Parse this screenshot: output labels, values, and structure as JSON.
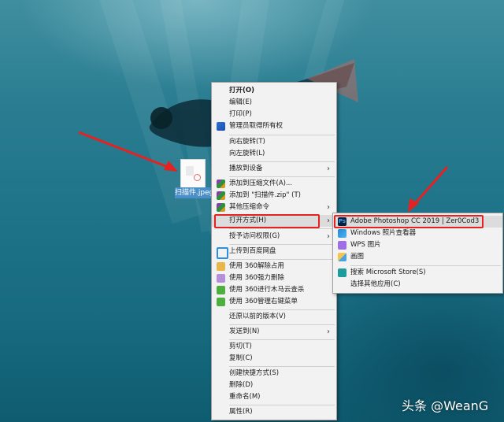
{
  "desktop": {
    "file_name": "扫描件.jpeg"
  },
  "context_menu": {
    "items": [
      {
        "label": "打开(O)",
        "bold": true
      },
      {
        "label": "编辑(E)"
      },
      {
        "label": "打印(P)"
      },
      {
        "label": "管理员取得所有权",
        "icon": "shield-icon"
      },
      {
        "label": "向右旋转(T)"
      },
      {
        "label": "向左旋转(L)"
      },
      {
        "label": "播放到设备",
        "submenu": true
      },
      {
        "label": "添加到压缩文件(A)...",
        "icon": "archive-icon"
      },
      {
        "label": "添加到 \"扫描件.zip\" (T)",
        "icon": "archive-icon"
      },
      {
        "label": "其他压缩命令",
        "icon": "archive-icon",
        "submenu": true
      },
      {
        "label": "打开方式(H)",
        "submenu": true,
        "highlighted": true
      },
      {
        "label": "授予访问权限(G)",
        "submenu": true
      },
      {
        "label": "上传到百度网盘",
        "icon": "cloud-icon"
      },
      {
        "label": "使用 360解除占用",
        "icon": "unlock-360-icon"
      },
      {
        "label": "使用 360强力删除",
        "icon": "delete-360-icon"
      },
      {
        "label": "使用 360进行木马云查杀",
        "icon": "scan-360-icon"
      },
      {
        "label": "使用 360管理右键菜单",
        "icon": "manage-360-icon"
      },
      {
        "label": "还原以前的版本(V)"
      },
      {
        "label": "发送到(N)",
        "submenu": true
      },
      {
        "label": "剪切(T)"
      },
      {
        "label": "复制(C)"
      },
      {
        "label": "创建快捷方式(S)"
      },
      {
        "label": "删除(D)"
      },
      {
        "label": "重命名(M)"
      },
      {
        "label": "属性(R)"
      }
    ],
    "submenu_arrow": "›"
  },
  "open_with_menu": {
    "items": [
      {
        "label": "Adobe Photoshop CC 2019 | Zer0Cod3",
        "icon": "photoshop-icon",
        "icon_text": "Ps"
      },
      {
        "label": "Windows 照片查看器",
        "icon": "photo-viewer-icon"
      },
      {
        "label": "WPS 图片",
        "icon": "wps-icon"
      },
      {
        "label": "画图",
        "icon": "paint-icon"
      },
      {
        "label": "搜索 Microsoft Store(S)",
        "icon": "store-icon"
      },
      {
        "label": "选择其他应用(C)"
      }
    ]
  },
  "watermark": "头条 @WeanG",
  "colors": {
    "annotation_red": "#e42222",
    "menu_bg": "#f2f2f2",
    "highlight_bg": "#dcdcdc"
  }
}
